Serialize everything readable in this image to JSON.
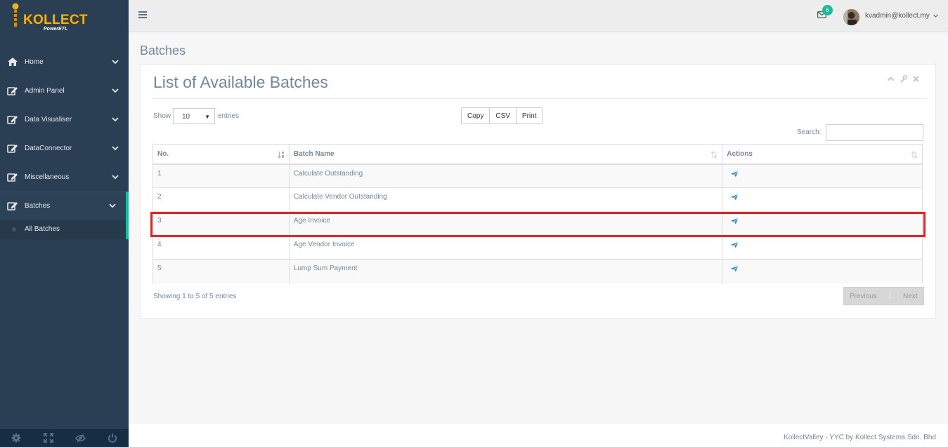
{
  "logo": {
    "brand": "KOLLECT",
    "sub": "PowerETL"
  },
  "sidebar": {
    "items": [
      {
        "label": "Home",
        "icon": "home-icon"
      },
      {
        "label": "Admin Panel",
        "icon": "edit-icon"
      },
      {
        "label": "Data Visualiser",
        "icon": "edit-icon"
      },
      {
        "label": "DataConnector",
        "icon": "edit-icon"
      },
      {
        "label": "Miscellaneous",
        "icon": "edit-icon"
      },
      {
        "label": "Batches",
        "icon": "edit-icon"
      }
    ],
    "submenu": {
      "label": "All Batches"
    },
    "footer_icons": [
      "settings-icon",
      "fullscreen-icon",
      "hide-icon",
      "power-icon"
    ]
  },
  "topnav": {
    "mail_count": "6",
    "user": "kvadmin@kollect.my"
  },
  "page": {
    "title": "Batches",
    "panel_title": "List of Available Batches"
  },
  "table_controls": {
    "show_label": "Show",
    "page_size": "10",
    "entries_label": "entries",
    "buttons": [
      "Copy",
      "CSV",
      "Print"
    ],
    "search_label": "Search:"
  },
  "table": {
    "headers": [
      "No.",
      "Batch Name",
      "Actions"
    ],
    "rows": [
      {
        "no": "1",
        "name": "Calculate Outstanding"
      },
      {
        "no": "2",
        "name": "Calculate Vendor Outstanding"
      },
      {
        "no": "3",
        "name": "Age Invoice"
      },
      {
        "no": "4",
        "name": "Age Vendor Invoice"
      },
      {
        "no": "5",
        "name": "Lump Sum Payment"
      }
    ]
  },
  "pagination": {
    "info": "Showing 1 to 5 of 5 entries",
    "previous": "Previous",
    "page": "1",
    "next": "Next"
  },
  "footer": {
    "text": "KollectValley - YYC by Kollect Systems Sdn. Bhd"
  },
  "colors": {
    "sidebar": "#2A3F54",
    "accent": "#1ABB9C",
    "highlight": "#E0242B"
  }
}
